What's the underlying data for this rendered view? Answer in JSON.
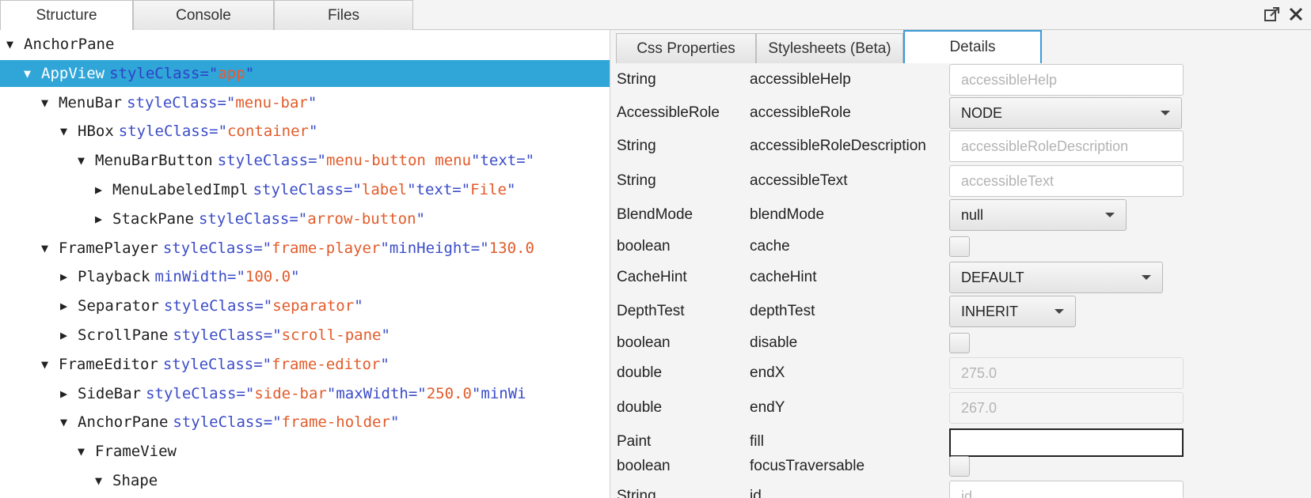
{
  "top_tabs": [
    {
      "label": "Structure",
      "active": true
    },
    {
      "label": "Console",
      "active": false
    },
    {
      "label": "Files",
      "active": false
    }
  ],
  "top_actions": {
    "popout_icon": "popout-icon",
    "close_icon": "close-icon"
  },
  "tree": [
    {
      "arrow": "▼",
      "node": "AnchorPane",
      "attrs": []
    },
    {
      "arrow": "▼",
      "node": "AppView",
      "attrs": [
        {
          "name": "styleClass=\"",
          "value": "app",
          "end": "\""
        }
      ],
      "selected": true
    },
    {
      "arrow": "▼",
      "node": "MenuBar",
      "attrs": [
        {
          "name": "styleClass=\"",
          "value": "menu-bar",
          "end": "\""
        }
      ]
    },
    {
      "arrow": "▼",
      "node": "HBox",
      "attrs": [
        {
          "name": "styleClass=\"",
          "value": "container",
          "end": "\""
        }
      ]
    },
    {
      "arrow": "▼",
      "node": "MenuBarButton",
      "attrs": [
        {
          "name": "styleClass=\"",
          "value": "menu-button menu",
          "end": "\""
        },
        {
          "name": " text=\"",
          "value": "",
          "end": ""
        }
      ]
    },
    {
      "arrow": "▶",
      "node": "MenuLabeledImpl",
      "attrs": [
        {
          "name": "styleClass=\"",
          "value": "label",
          "end": "\""
        },
        {
          "name": " text=\"",
          "value": "File",
          "end": "\""
        }
      ]
    },
    {
      "arrow": "▶",
      "node": "StackPane",
      "attrs": [
        {
          "name": "styleClass=\"",
          "value": "arrow-button",
          "end": "\""
        }
      ]
    },
    {
      "arrow": "▼",
      "node": "FramePlayer",
      "attrs": [
        {
          "name": "styleClass=\"",
          "value": "frame-player",
          "end": "\""
        },
        {
          "name": " minHeight=\"",
          "value": "130.0",
          "end": ""
        }
      ]
    },
    {
      "arrow": "▶",
      "node": "Playback",
      "attrs": [
        {
          "name": "minWidth=\"",
          "value": "100.0",
          "end": "\""
        }
      ]
    },
    {
      "arrow": "▶",
      "node": "Separator",
      "attrs": [
        {
          "name": "styleClass=\"",
          "value": "separator",
          "end": "\""
        }
      ]
    },
    {
      "arrow": "▶",
      "node": "ScrollPane",
      "attrs": [
        {
          "name": "styleClass=\"",
          "value": "scroll-pane",
          "end": "\""
        }
      ]
    },
    {
      "arrow": "▼",
      "node": "FrameEditor",
      "attrs": [
        {
          "name": "styleClass=\"",
          "value": "frame-editor",
          "end": "\""
        }
      ]
    },
    {
      "arrow": "▶",
      "node": "SideBar",
      "attrs": [
        {
          "name": "styleClass=\"",
          "value": "side-bar",
          "end": "\""
        },
        {
          "name": " maxWidth=\"",
          "value": "250.0",
          "end": "\""
        },
        {
          "name": " minWi",
          "value": "",
          "end": ""
        }
      ]
    },
    {
      "arrow": "▼",
      "node": "AnchorPane",
      "attrs": [
        {
          "name": "styleClass=\"",
          "value": "frame-holder",
          "end": "\""
        }
      ]
    },
    {
      "arrow": "▼",
      "node": "FrameView",
      "attrs": []
    },
    {
      "arrow": "▼",
      "node": "Shape",
      "attrs": []
    }
  ],
  "sub_tabs": [
    {
      "label": "Css Properties",
      "active": false
    },
    {
      "label": "Stylesheets (Beta)",
      "active": false
    },
    {
      "label": "Details",
      "active": true
    }
  ],
  "properties": [
    {
      "type": "String",
      "name": "accessibleHelp",
      "control": "text",
      "text": "accessibleHelp"
    },
    {
      "type": "AccessibleRole",
      "name": "accessibleRole",
      "control": "combo",
      "text": "NODE"
    },
    {
      "type": "String",
      "name": "accessibleRoleDescription",
      "control": "text",
      "text": "accessibleRoleDescription"
    },
    {
      "type": "String",
      "name": "accessibleText",
      "control": "text",
      "text": "accessibleText"
    },
    {
      "type": "BlendMode",
      "name": "blendMode",
      "control": "combo",
      "text": "null"
    },
    {
      "type": "boolean",
      "name": "cache",
      "control": "checkbox",
      "text": ""
    },
    {
      "type": "CacheHint",
      "name": "cacheHint",
      "control": "combo",
      "text": "DEFAULT"
    },
    {
      "type": "DepthTest",
      "name": "depthTest",
      "control": "combo",
      "text": "INHERIT"
    },
    {
      "type": "boolean",
      "name": "disable",
      "control": "checkbox",
      "text": ""
    },
    {
      "type": "double",
      "name": "endX",
      "control": "disabled",
      "text": "275.0"
    },
    {
      "type": "double",
      "name": "endY",
      "control": "disabled",
      "text": "267.0"
    },
    {
      "type": "Paint",
      "name": "fill",
      "control": "paint",
      "text": ""
    },
    {
      "type": "boolean",
      "name": "focusTraversable",
      "control": "checkbox",
      "text": ""
    },
    {
      "type": "String",
      "name": "id",
      "control": "text",
      "text": "id"
    }
  ]
}
